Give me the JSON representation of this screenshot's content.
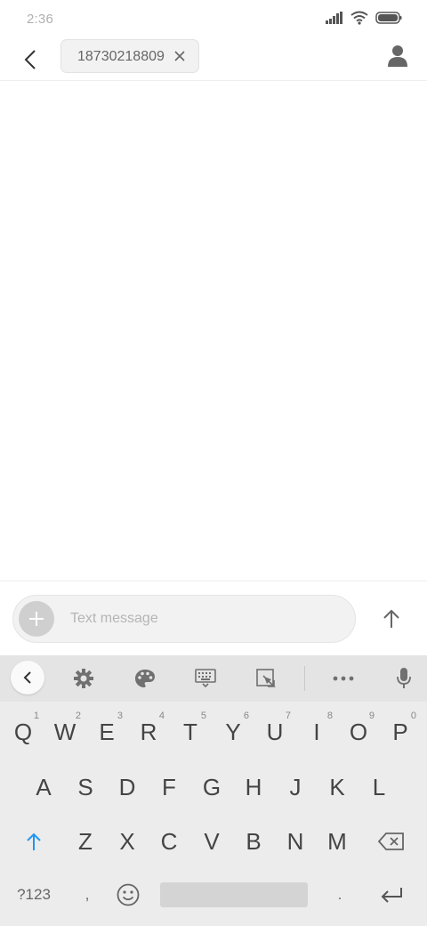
{
  "status_bar": {
    "time": "2:36"
  },
  "header": {
    "recipient": "18730218809"
  },
  "composer": {
    "placeholder": "Text message"
  },
  "keyboard": {
    "row1": [
      {
        "label": "Q",
        "hint": "1"
      },
      {
        "label": "W",
        "hint": "2"
      },
      {
        "label": "E",
        "hint": "3"
      },
      {
        "label": "R",
        "hint": "4"
      },
      {
        "label": "T",
        "hint": "5"
      },
      {
        "label": "Y",
        "hint": "6"
      },
      {
        "label": "U",
        "hint": "7"
      },
      {
        "label": "I",
        "hint": "8"
      },
      {
        "label": "O",
        "hint": "9"
      },
      {
        "label": "P",
        "hint": "0"
      }
    ],
    "row2": [
      "A",
      "S",
      "D",
      "F",
      "G",
      "H",
      "J",
      "K",
      "L"
    ],
    "row3": [
      "Z",
      "X",
      "C",
      "V",
      "B",
      "N",
      "M"
    ],
    "symbols_label": "?123",
    "comma_label": ",",
    "period_label": "."
  },
  "colors": {
    "accent": "#2196F3",
    "keyboard_bg": "#ececec",
    "toolbar_bg": "#e4e4e4"
  }
}
